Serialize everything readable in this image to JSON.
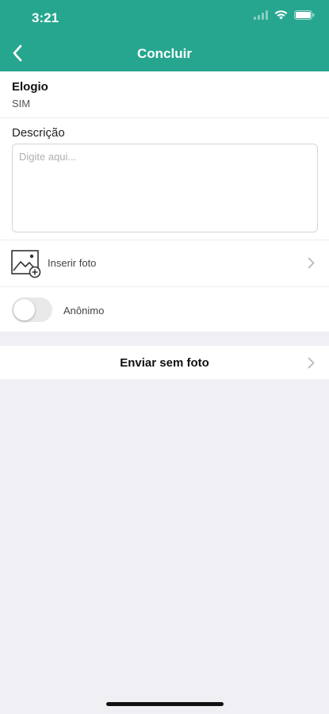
{
  "status_bar": {
    "time": "3:21",
    "icons": [
      "signal-icon",
      "wifi-icon",
      "battery-icon"
    ]
  },
  "nav": {
    "title": "Concluir",
    "back_icon": "chevron-left-icon"
  },
  "form": {
    "type_label": "Elogio",
    "type_value": "SIM",
    "description_label": "Descrição",
    "description_placeholder": "Digite aqui...",
    "description_value": "",
    "photo_label": "Inserir foto",
    "photo_icon": "add-photo-icon",
    "anonymous_label": "Anônimo",
    "anonymous_enabled": false
  },
  "actions": {
    "send_label": "Enviar sem foto"
  },
  "colors": {
    "header": "#26a68f",
    "background": "#efeff4"
  }
}
